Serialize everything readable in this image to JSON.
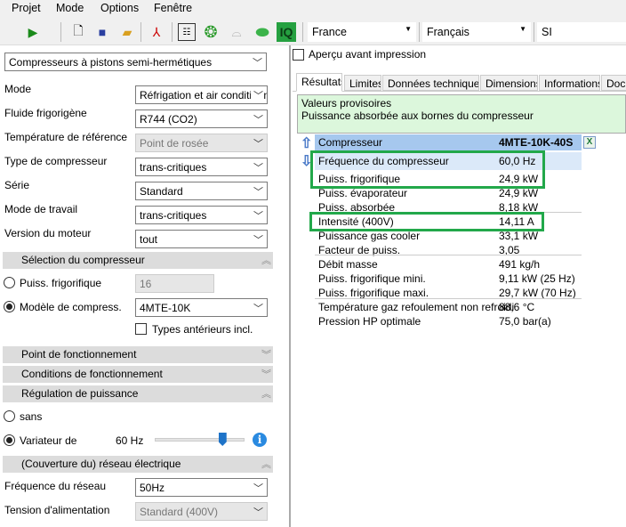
{
  "menu": [
    "Projet",
    "Mode",
    "Options",
    "Fenêtre"
  ],
  "toolbar": {
    "country": "France",
    "language": "Français",
    "units": "SI",
    "icons": [
      "play-icon",
      "new-file-icon",
      "save-icon",
      "open-folder-icon",
      "pdf-icon",
      "table-icon",
      "compressor-icon",
      "condenser-icon",
      "cylinder-icon",
      "iq-icon"
    ]
  },
  "left": {
    "product_type": "Compresseurs à pistons semi-hermétiques",
    "fields": [
      {
        "label": "Mode",
        "value": "Réfrigation et air conditionnement",
        "disabled": false
      },
      {
        "label": "Fluide frigorigène",
        "value": "R744 (CO2)",
        "disabled": false
      },
      {
        "label": "Température de référence",
        "value": "Point de rosée",
        "disabled": true
      },
      {
        "label": "Type de compresseur",
        "value": "trans-critiques",
        "disabled": false
      },
      {
        "label": "Série",
        "value": "Standard",
        "disabled": false
      },
      {
        "label": "Mode de travail",
        "value": "trans-critiques",
        "disabled": false
      },
      {
        "label": "Version du moteur",
        "value": "tout",
        "disabled": false
      }
    ],
    "sections": {
      "selection": "Sélection du compresseur",
      "point": "Point de fonctionnement",
      "conditions": "Conditions de fonctionnement",
      "regulation": "Régulation de puissance",
      "reseau": "(Couverture du) réseau électrique"
    },
    "puiss_label": "Puiss. frigorifique",
    "puiss_value": "16",
    "modele_label": "Modèle de compress.",
    "modele_value": "4MTE-10K",
    "types_anterieurs": "Types antérieurs incl.",
    "sans": "sans",
    "variateur": "Variateur de",
    "freq": "60 Hz",
    "slider_fraction": 0.75,
    "freq_reseau_label": "Fréquence du réseau",
    "freq_reseau_value": "50Hz",
    "tension_label": "Tension d'alimentation",
    "tension_value": "Standard (400V)"
  },
  "right": {
    "apercu": "Aperçu avant impression",
    "tabs": [
      "Résultats",
      "Limites",
      "Données techniques",
      "Dimensions",
      "Informations",
      "Docu"
    ],
    "info": [
      "Valeurs provisoires",
      "Puissance absorbée aux bornes du compresseur"
    ],
    "compressor_label": "Compresseur",
    "compressor_value": "4MTE-10K-40S",
    "rows": [
      {
        "label": "Fréquence du compresseur",
        "value": "60,0 Hz"
      },
      {
        "label": "Puiss. frigorifique",
        "value": "24,9  kW"
      },
      {
        "label": "Puiss. évaporateur",
        "value": "24,9  kW"
      },
      {
        "label": "Puiss. absorbée",
        "value": "8,18  kW"
      },
      {
        "label": "Intensité (400V)",
        "value": "14,11  A"
      },
      {
        "label": "Puissance gas cooler",
        "value": "33,1  kW"
      },
      {
        "label": "Facteur de puiss.",
        "value": "3,05"
      },
      {
        "label": "Débit masse",
        "value": "491  kg/h"
      },
      {
        "label": "Puiss. frigorifique mini.",
        "value": "9,11 kW (25 Hz)"
      },
      {
        "label": "Puiss. frigorifique maxi.",
        "value": "29,7 kW (70 Hz)"
      },
      {
        "label": "Température gaz refoulement non refroidi",
        "value": "88,6  °C"
      },
      {
        "label": "Pression HP optimale",
        "value": "75,0  bar(a)"
      }
    ]
  }
}
